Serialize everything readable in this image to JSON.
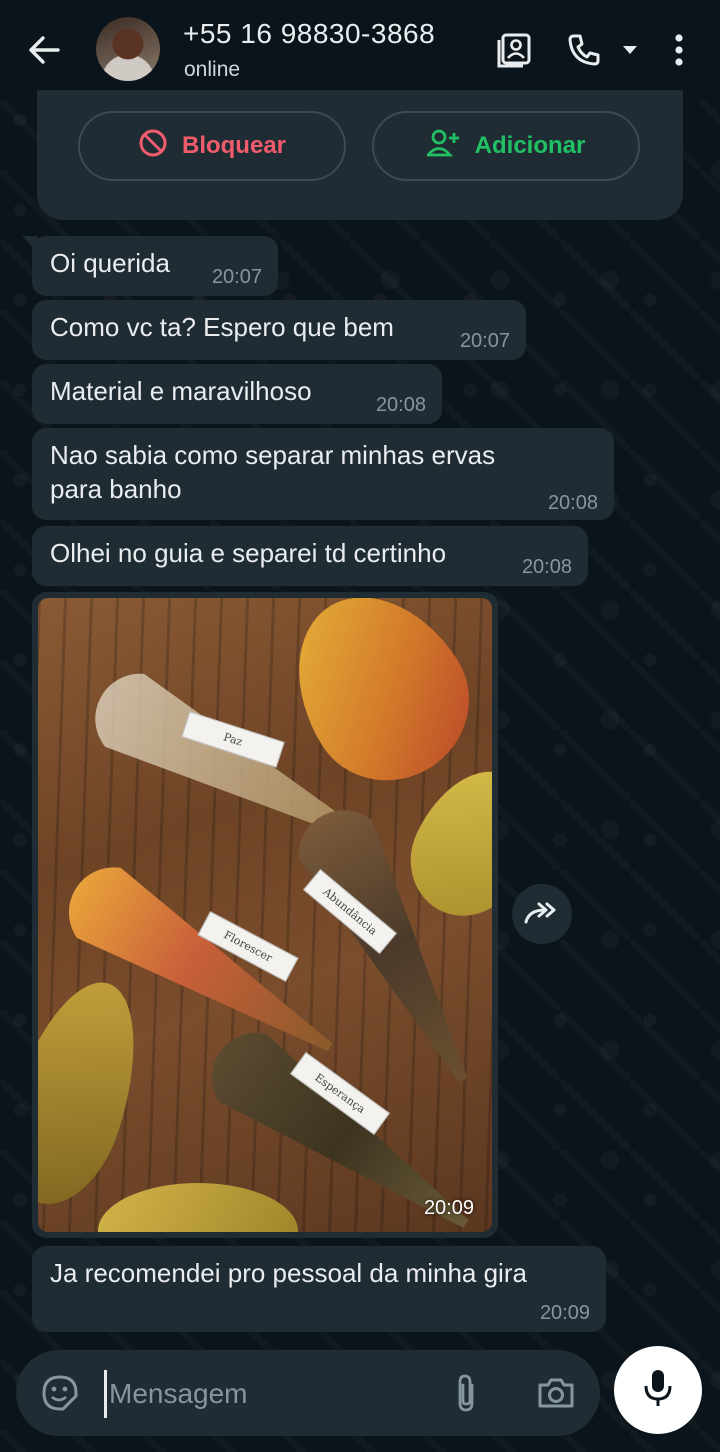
{
  "header": {
    "contact_name": "+55 16 98830-3868",
    "status": "online"
  },
  "actions": {
    "block_label": "Bloquear",
    "add_label": "Adicionar"
  },
  "messages": [
    {
      "text": "Oi querida",
      "time": "20:07"
    },
    {
      "text": "Como vc ta? Espero que bem",
      "time": "20:07"
    },
    {
      "text": "Material e maravilhoso",
      "time": "20:08"
    },
    {
      "text_line1": "Nao sabia como separar minhas ervas",
      "text_line2": "para banho",
      "time": "20:08"
    },
    {
      "text": "Olhei no guia e separei td certinho",
      "time": "20:08"
    },
    {
      "type": "image",
      "time": "20:09",
      "labels": [
        "Paz",
        "Florescer",
        "Abundância",
        "Esperança"
      ]
    },
    {
      "text": "Ja recomendei pro pessoal da minha gira",
      "time": "20:09"
    }
  ],
  "composer": {
    "placeholder": "Mensagem"
  },
  "colors": {
    "background": "#0b141a",
    "bubble": "#1f2c33",
    "block_red": "#f15c6d",
    "add_green": "#21c063",
    "meta_gray": "#8696a0"
  },
  "icons": [
    "back-arrow-icon",
    "contact-card-icon",
    "phone-icon",
    "dropdown-caret-icon",
    "more-vert-icon",
    "block-icon",
    "add-person-icon",
    "forward-icon",
    "sticker-icon",
    "attach-icon",
    "camera-icon",
    "mic-icon"
  ]
}
